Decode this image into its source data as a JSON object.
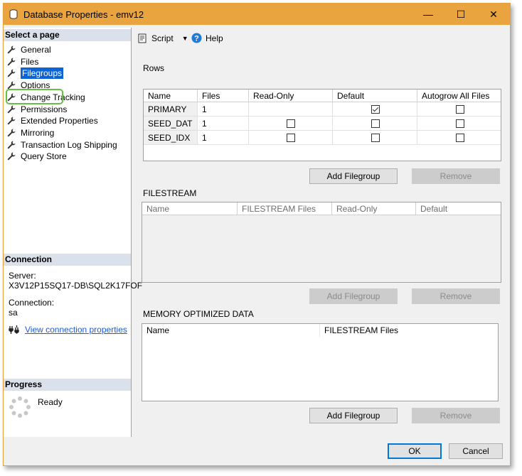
{
  "window": {
    "title": "Database Properties - emv12",
    "min": "—",
    "max": "☐",
    "close": "✕"
  },
  "left": {
    "select_page_header": "Select a page",
    "nav": [
      {
        "label": "General"
      },
      {
        "label": "Files"
      },
      {
        "label": "Filegroups"
      },
      {
        "label": "Options"
      },
      {
        "label": "Change Tracking"
      },
      {
        "label": "Permissions"
      },
      {
        "label": "Extended Properties"
      },
      {
        "label": "Mirroring"
      },
      {
        "label": "Transaction Log Shipping"
      },
      {
        "label": "Query Store"
      }
    ],
    "selected_index": 2,
    "connection_header": "Connection",
    "server_label": "Server:",
    "server_value": "X3V12P15SQ17-DB\\SQL2K17FOF",
    "connection_label": "Connection:",
    "connection_value": "sa",
    "view_conn_link": "View connection properties",
    "progress_header": "Progress",
    "progress_status": "Ready"
  },
  "toolbar": {
    "script_label": "Script",
    "help_label": "Help"
  },
  "rows": {
    "title": "Rows",
    "columns": [
      "Name",
      "Files",
      "Read-Only",
      "Default",
      "Autogrow All Files"
    ],
    "items": [
      {
        "name": "PRIMARY",
        "files": "1",
        "read_only": null,
        "default": true,
        "autogrow": false
      },
      {
        "name": "SEED_DAT",
        "files": "1",
        "read_only": false,
        "default": false,
        "autogrow": false
      },
      {
        "name": "SEED_IDX",
        "files": "1",
        "read_only": false,
        "default": false,
        "autogrow": false
      }
    ],
    "add_button": "Add Filegroup",
    "remove_button": "Remove"
  },
  "filestream": {
    "title": "FILESTREAM",
    "columns": [
      "Name",
      "FILESTREAM Files",
      "Read-Only",
      "Default"
    ],
    "add_button": "Add Filegroup",
    "remove_button": "Remove"
  },
  "memory": {
    "title": "MEMORY OPTIMIZED DATA",
    "columns": [
      "Name",
      "FILESTREAM Files"
    ],
    "add_button": "Add Filegroup",
    "remove_button": "Remove"
  },
  "footer": {
    "ok": "OK",
    "cancel": "Cancel"
  },
  "colors": {
    "titlebar": "#e9a33f",
    "selection": "#0a64d6",
    "highlight_ring": "#67c046",
    "section_header": "#dbe1ea",
    "link": "#1a5cd6"
  }
}
